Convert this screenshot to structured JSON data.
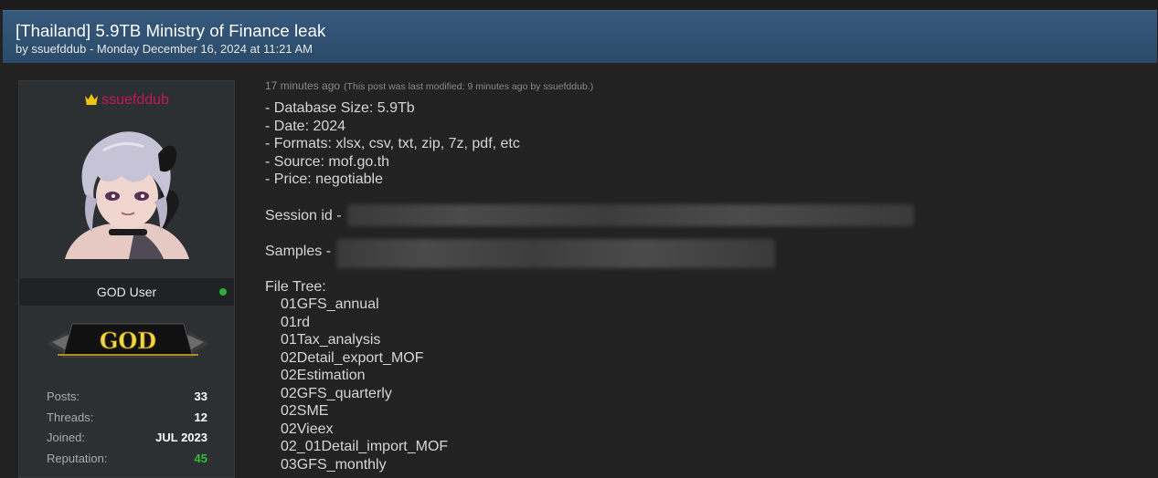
{
  "thread": {
    "title": "[Thailand] 5.9TB Ministry of Finance leak",
    "byline": "by ssuefddub - Monday December 16, 2024 at 11:21 AM"
  },
  "user": {
    "name": "ssuefddub",
    "rank": "GOD User",
    "badge": "GOD",
    "name_color": "#c1185a",
    "stats": [
      {
        "label": "Posts:",
        "value": "33"
      },
      {
        "label": "Threads:",
        "value": "12"
      },
      {
        "label": "Joined:",
        "value": "JUL 2023"
      },
      {
        "label": "Reputation:",
        "value": "45"
      }
    ]
  },
  "post": {
    "time": "17 minutes ago",
    "modified": "(This post was last modified: 9 minutes ago by ssuefddub.)",
    "details": [
      "- Database Size: 5.9Tb",
      "- Date: 2024",
      "- Formats: xlsx, csv, txt, zip, 7z, pdf, etc",
      "- Source: mof.go.th",
      "- Price: negotiable"
    ],
    "session_label": "Session id -",
    "samples_label": "Samples -",
    "file_tree_label": "File Tree:",
    "file_tree": [
      "01GFS_annual",
      "01rd",
      "01Tax_analysis",
      "02Detail_export_MOF",
      "02Estimation",
      "02GFS_quarterly",
      "02SME",
      "02Vieex",
      "02_01Detail_import_MOF",
      "03GFS_monthly"
    ]
  }
}
